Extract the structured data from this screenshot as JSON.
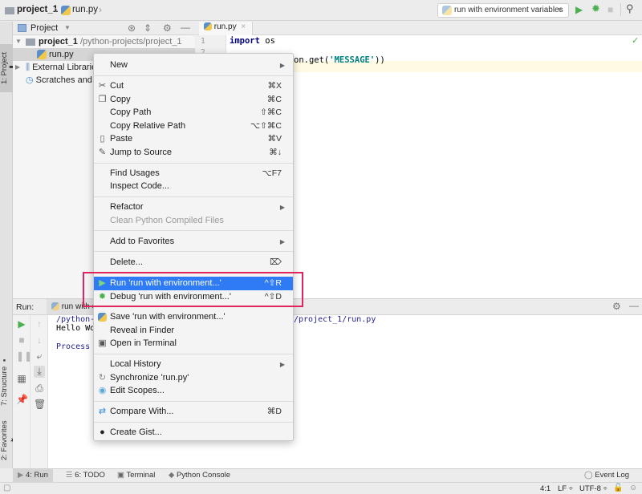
{
  "navbar": {
    "breadcrumb_project": "project_1",
    "breadcrumb_file": "run.py",
    "run_config": "run with environment variables",
    "icons": [
      "run-icon",
      "debug-icon",
      "stop-icon",
      "search-icon"
    ]
  },
  "left_stripe": {
    "project_tab": "1: Project",
    "structure_tab": "7: Structure",
    "favorites_tab": "2: Favorites"
  },
  "project_panel": {
    "header_label": "Project",
    "tree": [
      {
        "label": "project_1",
        "path": "/python-projects/project_1"
      },
      {
        "label": "run.py"
      },
      {
        "label": "External Libraries"
      },
      {
        "label": "Scratches and Consoles"
      }
    ]
  },
  "editor": {
    "tab_label": "run.py",
    "line_numbers": [
      "1",
      "2"
    ],
    "code": {
      "line1_kw": "import",
      "line1_rest": " os",
      "line3_visible": "on.get(",
      "line3_str": "'MESSAGE'",
      "line3_end": "))"
    }
  },
  "run_panel": {
    "label": "Run:",
    "tab_label": "run with e",
    "output": [
      "/python-",
      "Hello Wo",
      "Process "
    ],
    "output_tail": "/project_1/run.py"
  },
  "bottom_tabs": [
    {
      "label": "4: Run"
    },
    {
      "label": "6: TODO"
    },
    {
      "label": "Terminal"
    },
    {
      "label": "Python Console"
    }
  ],
  "event_log": "Event Log",
  "status": {
    "position": "4:1",
    "line_sep": "LF ÷",
    "encoding": "UTF-8 ÷"
  },
  "context_menu": {
    "items": [
      {
        "label": "New",
        "submenu": true
      },
      {
        "label": "Cut",
        "shortcut": "⌘X",
        "icon": "scissors-icon"
      },
      {
        "label": "Copy",
        "shortcut": "⌘C",
        "icon": "copy-icon"
      },
      {
        "label": "Copy Path",
        "shortcut": "⇧⌘C"
      },
      {
        "label": "Copy Relative Path",
        "shortcut": "⌥⇧⌘C"
      },
      {
        "label": "Paste",
        "shortcut": "⌘V",
        "icon": "paste-icon"
      },
      {
        "label": "Jump to Source",
        "shortcut": "⌘↓",
        "icon": "pencil-icon"
      },
      {
        "label": "Find Usages",
        "shortcut": "⌥F7"
      },
      {
        "label": "Inspect Code..."
      },
      {
        "label": "Refactor",
        "submenu": true
      },
      {
        "label": "Clean Python Compiled Files",
        "disabled": true
      },
      {
        "label": "Add to Favorites",
        "submenu": true
      },
      {
        "label": "Delete...",
        "shortcut": "⌦"
      },
      {
        "label": "Run 'run with environment...'",
        "shortcut": "^⇧R",
        "highlighted": true,
        "icon": "run-icon"
      },
      {
        "label": "Debug 'run with environment...'",
        "shortcut": "^⇧D",
        "icon": "debug-icon"
      },
      {
        "label": "Save 'run with environment...'",
        "icon": "python-icon"
      },
      {
        "label": "Reveal in Finder"
      },
      {
        "label": "Open in Terminal",
        "icon": "terminal-icon"
      },
      {
        "label": "Local History",
        "submenu": true
      },
      {
        "label": "Synchronize 'run.py'",
        "icon": "sync-icon"
      },
      {
        "label": "Edit Scopes...",
        "icon": "scope-icon"
      },
      {
        "label": "Compare With...",
        "shortcut": "⌘D",
        "icon": "compare-icon"
      },
      {
        "label": "Create Gist...",
        "icon": "github-icon"
      }
    ]
  },
  "colors": {
    "highlight": "#2f7bf5",
    "annotation_box": "#e0245e",
    "run_green": "#4caf50"
  }
}
